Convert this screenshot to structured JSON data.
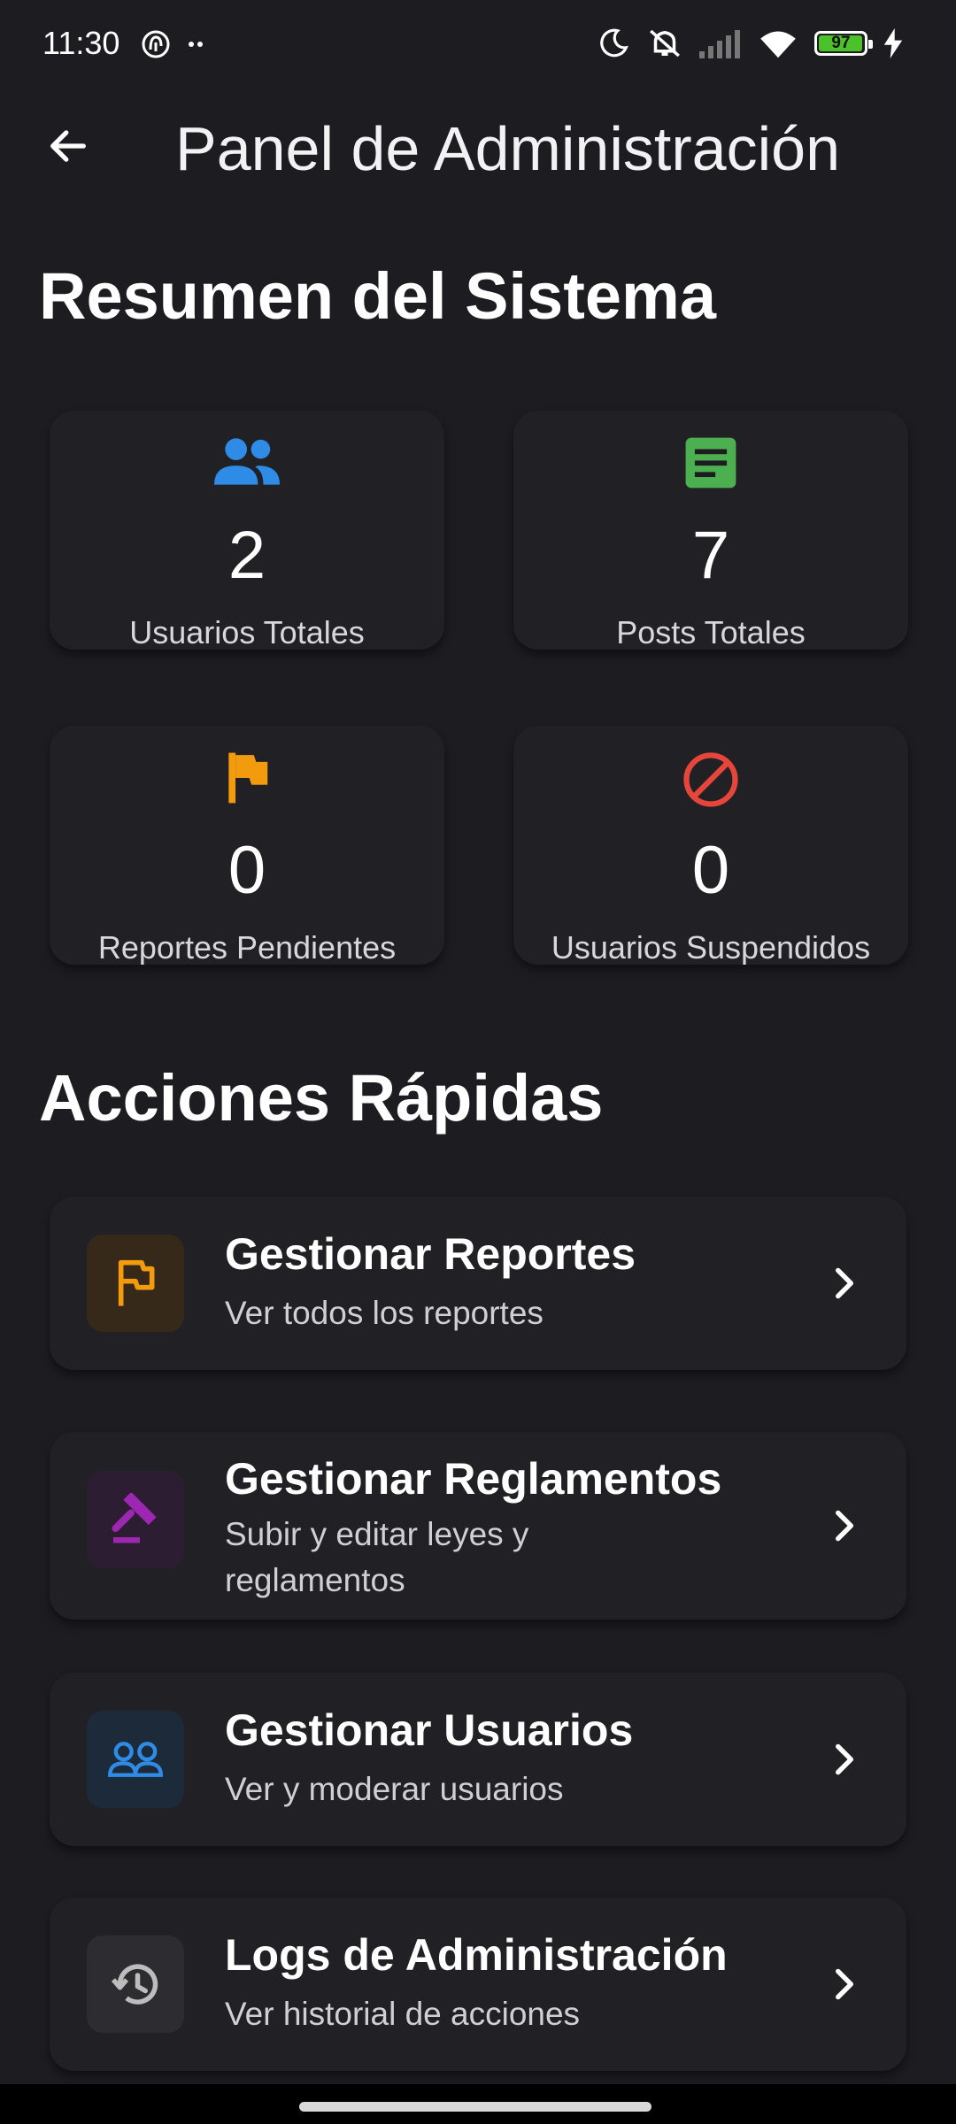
{
  "status_bar": {
    "time": "11:30",
    "battery_level": "97",
    "battery_fraction": 0.97
  },
  "app_bar": {
    "title": "Panel de Administración"
  },
  "summary": {
    "title": "Resumen del Sistema",
    "cards": [
      {
        "value": "2",
        "label": "Usuarios Totales",
        "icon": "group-icon",
        "color": "#2f8ce6"
      },
      {
        "value": "7",
        "label": "Posts Totales",
        "icon": "article-icon",
        "color": "#4caf50"
      },
      {
        "value": "0",
        "label": "Reportes Pendientes",
        "icon": "flag-icon",
        "color": "#f29b0e"
      },
      {
        "value": "0",
        "label": "Usuarios Suspendidos",
        "icon": "block-icon",
        "color": "#e5453a"
      }
    ]
  },
  "quick_actions": {
    "title": "Acciones Rápidas",
    "items": [
      {
        "title": "Gestionar Reportes",
        "subtitle": "Ver todos los reportes",
        "icon": "flag-outline-icon",
        "color": "#f29b0e"
      },
      {
        "title": "Gestionar Reglamentos",
        "subtitle": "Subir y editar leyes y reglamentos",
        "icon": "gavel-icon",
        "color": "#9c27b0"
      },
      {
        "title": "Gestionar Usuarios",
        "subtitle": "Ver y moderar usuarios",
        "icon": "people-outline-icon",
        "color": "#2f8ce6"
      },
      {
        "title": "Logs de Administración",
        "subtitle": "Ver historial de acciones",
        "icon": "history-icon",
        "color": "#bdbdbd"
      }
    ]
  }
}
